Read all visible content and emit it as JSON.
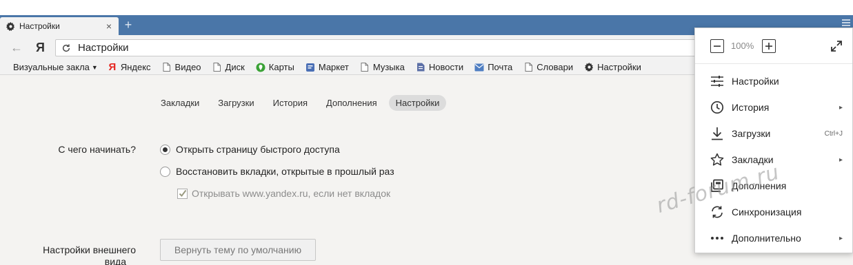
{
  "tab": {
    "title": "Настройки",
    "close": "×",
    "new_tab": "+"
  },
  "address": {
    "text": "Настройки",
    "logo": "Я",
    "back": "←"
  },
  "bookmarks": {
    "visual": "Визуальные закла",
    "visual_arrow": "▼",
    "items": [
      {
        "label": "Яндекс"
      },
      {
        "label": "Видео"
      },
      {
        "label": "Диск"
      },
      {
        "label": "Карты"
      },
      {
        "label": "Маркет"
      },
      {
        "label": "Музыка"
      },
      {
        "label": "Новости"
      },
      {
        "label": "Почта"
      },
      {
        "label": "Словари"
      },
      {
        "label": "Настройки"
      }
    ]
  },
  "nav": {
    "tabs": [
      {
        "label": "Закладки"
      },
      {
        "label": "Загрузки"
      },
      {
        "label": "История"
      },
      {
        "label": "Дополнения"
      },
      {
        "label": "Настройки"
      }
    ],
    "active_index": 4
  },
  "settings": {
    "start_label": "С чего начинать?",
    "option1": "Открыть страницу быстрого доступа",
    "option2": "Восстановить вкладки, открытые в прошлый раз",
    "option3": "Открывать www.yandex.ru, если нет вкладок",
    "appearance_label_1": "Настройки внешнего",
    "appearance_label_2": "вида",
    "reset_theme_button": "Вернуть тему по умолчанию"
  },
  "menu": {
    "zoom_level": "100%",
    "items": [
      {
        "label": "Настройки",
        "icon": "settings-sliders-icon"
      },
      {
        "label": "История",
        "icon": "clock-icon",
        "arrow": "▸"
      },
      {
        "label": "Загрузки",
        "icon": "download-icon",
        "shortcut": "Ctrl+J"
      },
      {
        "label": "Закладки",
        "icon": "star-icon",
        "arrow": "▸"
      },
      {
        "label": "Дополнения",
        "icon": "addons-icon"
      },
      {
        "label": "Синхронизация",
        "icon": "sync-icon"
      },
      {
        "label": "Дополнительно",
        "icon": "more-dots-icon",
        "arrow": "▸"
      }
    ]
  },
  "watermark": "rd-forum.ru",
  "colors": {
    "tabstrip": "#4a76a8",
    "page_bg": "#f4f3f1",
    "yandex_red": "#e52620"
  }
}
